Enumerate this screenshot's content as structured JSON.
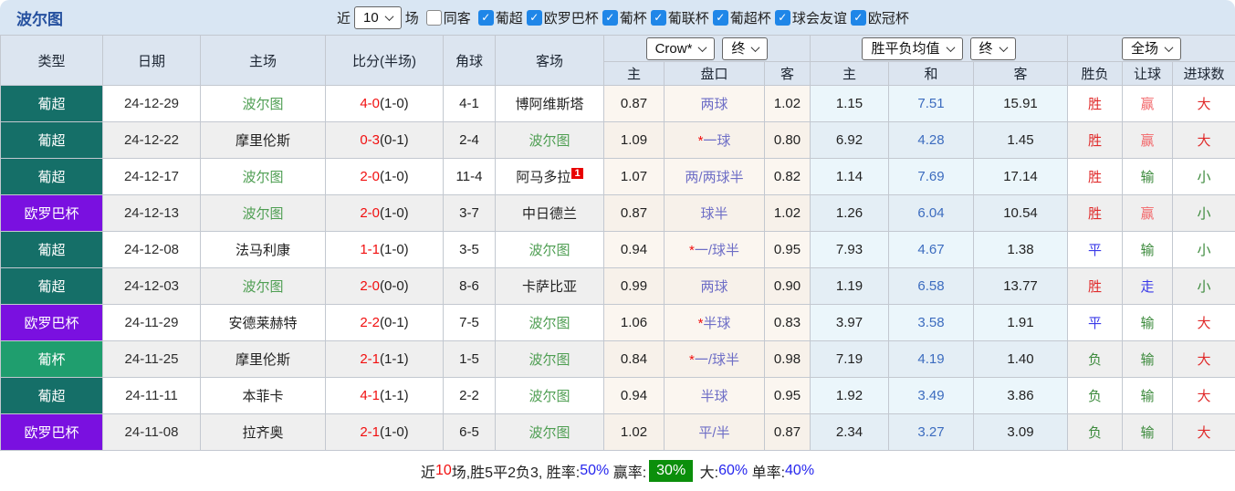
{
  "header": {
    "title": "波尔图"
  },
  "toolbar": {
    "recent_label": "近",
    "recent_value": "10",
    "matches_label": "场",
    "same_away_label": "同客",
    "same_away_checked": false,
    "leagues": [
      {
        "label": "葡超",
        "checked": true
      },
      {
        "label": "欧罗巴杯",
        "checked": true
      },
      {
        "label": "葡杯",
        "checked": true
      },
      {
        "label": "葡联杯",
        "checked": true
      },
      {
        "label": "葡超杯",
        "checked": true
      },
      {
        "label": "球会友谊",
        "checked": true
      },
      {
        "label": "欧冠杯",
        "checked": true
      }
    ]
  },
  "table": {
    "main_headers": [
      "类型",
      "日期",
      "主场",
      "比分(半场)",
      "角球",
      "客场"
    ],
    "sub_headers": [
      "主",
      "盘口",
      "客",
      "主",
      "和",
      "客",
      "胜负",
      "让球",
      "进球数"
    ],
    "selects": {
      "bookmaker": "Crow*",
      "asian_stage": "终",
      "europe_type": "胜平负均值",
      "europe_stage": "终",
      "scope": "全场"
    },
    "rows": [
      {
        "league": "葡超",
        "date": "24-12-29",
        "home": "波尔图",
        "score": "4-0",
        "half": "(1-0)",
        "corner": "4-1",
        "away": "博阿维斯塔",
        "away_sup": "",
        "asian": [
          "0.87",
          "两球",
          "1.02"
        ],
        "euro": [
          "1.15",
          "7.51",
          "15.91"
        ],
        "result": [
          "胜",
          "赢",
          "大"
        ]
      },
      {
        "league": "葡超",
        "date": "24-12-22",
        "home": "摩里伦斯",
        "score": "0-3",
        "half": "(0-1)",
        "corner": "2-4",
        "away": "波尔图",
        "away_sup": "",
        "asian": [
          "1.09",
          "*一球",
          "0.80"
        ],
        "euro": [
          "6.92",
          "4.28",
          "1.45"
        ],
        "result": [
          "胜",
          "赢",
          "大"
        ]
      },
      {
        "league": "葡超",
        "date": "24-12-17",
        "home": "波尔图",
        "score": "2-0",
        "half": "(1-0)",
        "corner": "11-4",
        "away": "阿马多拉",
        "away_sup": "1",
        "asian": [
          "1.07",
          "两/两球半",
          "0.82"
        ],
        "euro": [
          "1.14",
          "7.69",
          "17.14"
        ],
        "result": [
          "胜",
          "输",
          "小"
        ]
      },
      {
        "league": "欧罗巴杯",
        "date": "24-12-13",
        "home": "波尔图",
        "score": "2-0",
        "half": "(1-0)",
        "corner": "3-7",
        "away": "中日德兰",
        "away_sup": "",
        "asian": [
          "0.87",
          "球半",
          "1.02"
        ],
        "euro": [
          "1.26",
          "6.04",
          "10.54"
        ],
        "result": [
          "胜",
          "赢",
          "小"
        ]
      },
      {
        "league": "葡超",
        "date": "24-12-08",
        "home": "法马利康",
        "score": "1-1",
        "half": "(1-0)",
        "corner": "3-5",
        "away": "波尔图",
        "away_sup": "",
        "asian": [
          "0.94",
          "*一/球半",
          "0.95"
        ],
        "euro": [
          "7.93",
          "4.67",
          "1.38"
        ],
        "result": [
          "平",
          "输",
          "小"
        ]
      },
      {
        "league": "葡超",
        "date": "24-12-03",
        "home": "波尔图",
        "score": "2-0",
        "half": "(0-0)",
        "corner": "8-6",
        "away": "卡萨比亚",
        "away_sup": "",
        "asian": [
          "0.99",
          "两球",
          "0.90"
        ],
        "euro": [
          "1.19",
          "6.58",
          "13.77"
        ],
        "result": [
          "胜",
          "走",
          "小"
        ]
      },
      {
        "league": "欧罗巴杯",
        "date": "24-11-29",
        "home": "安德莱赫特",
        "score": "2-2",
        "half": "(0-1)",
        "corner": "7-5",
        "away": "波尔图",
        "away_sup": "",
        "asian": [
          "1.06",
          "*半球",
          "0.83"
        ],
        "euro": [
          "3.97",
          "3.58",
          "1.91"
        ],
        "result": [
          "平",
          "输",
          "大"
        ]
      },
      {
        "league": "葡杯",
        "date": "24-11-25",
        "home": "摩里伦斯",
        "score": "2-1",
        "half": "(1-1)",
        "corner": "1-5",
        "away": "波尔图",
        "away_sup": "",
        "asian": [
          "0.84",
          "*一/球半",
          "0.98"
        ],
        "euro": [
          "7.19",
          "4.19",
          "1.40"
        ],
        "result": [
          "负",
          "输",
          "大"
        ]
      },
      {
        "league": "葡超",
        "date": "24-11-11",
        "home": "本菲卡",
        "score": "4-1",
        "half": "(1-1)",
        "corner": "2-2",
        "away": "波尔图",
        "away_sup": "",
        "asian": [
          "0.94",
          "半球",
          "0.95"
        ],
        "euro": [
          "1.92",
          "3.49",
          "3.86"
        ],
        "result": [
          "负",
          "输",
          "大"
        ]
      },
      {
        "league": "欧罗巴杯",
        "date": "24-11-08",
        "home": "拉齐奥",
        "score": "2-1",
        "half": "(1-0)",
        "corner": "6-5",
        "away": "波尔图",
        "away_sup": "",
        "asian": [
          "1.02",
          "平/半",
          "0.87"
        ],
        "euro": [
          "2.34",
          "3.27",
          "3.09"
        ],
        "result": [
          "负",
          "输",
          "大"
        ]
      }
    ]
  },
  "footer": {
    "segments": [
      {
        "text": "近",
        "style": "dark"
      },
      {
        "text": "10",
        "style": "red"
      },
      {
        "text": "场,胜5平2负3, 胜率:",
        "style": "dark"
      },
      {
        "text": "50%",
        "style": "blue"
      },
      {
        "text": " 赢率:",
        "style": "dark"
      },
      {
        "text": "30%",
        "style": "badge"
      },
      {
        "text": " 大:",
        "style": "dark"
      },
      {
        "text": "60%",
        "style": "blue"
      },
      {
        "text": " 单率:",
        "style": "dark"
      },
      {
        "text": "40%",
        "style": "blue"
      }
    ]
  },
  "colors": {
    "leagues": {
      "葡超": "#156f68",
      "欧罗巴杯": "#7a10e0",
      "葡杯": "#1f9e6e"
    },
    "focus_team_green": "#4e9e52",
    "score_red": "#f10f0f",
    "handicap_purple": "#6e6ec6",
    "euro_draw_blue": "#3c6cbf",
    "result_win_red": "#e02b2b",
    "result_draw_blue": "#3a3ae8",
    "result_loss_green": "#3c8a3c",
    "handicap_win_pink": "#f2686b",
    "checkbox_blue": "#1f86e8",
    "footer_badge_green": "#0b8f0b",
    "footer_blue": "#2626ee"
  }
}
